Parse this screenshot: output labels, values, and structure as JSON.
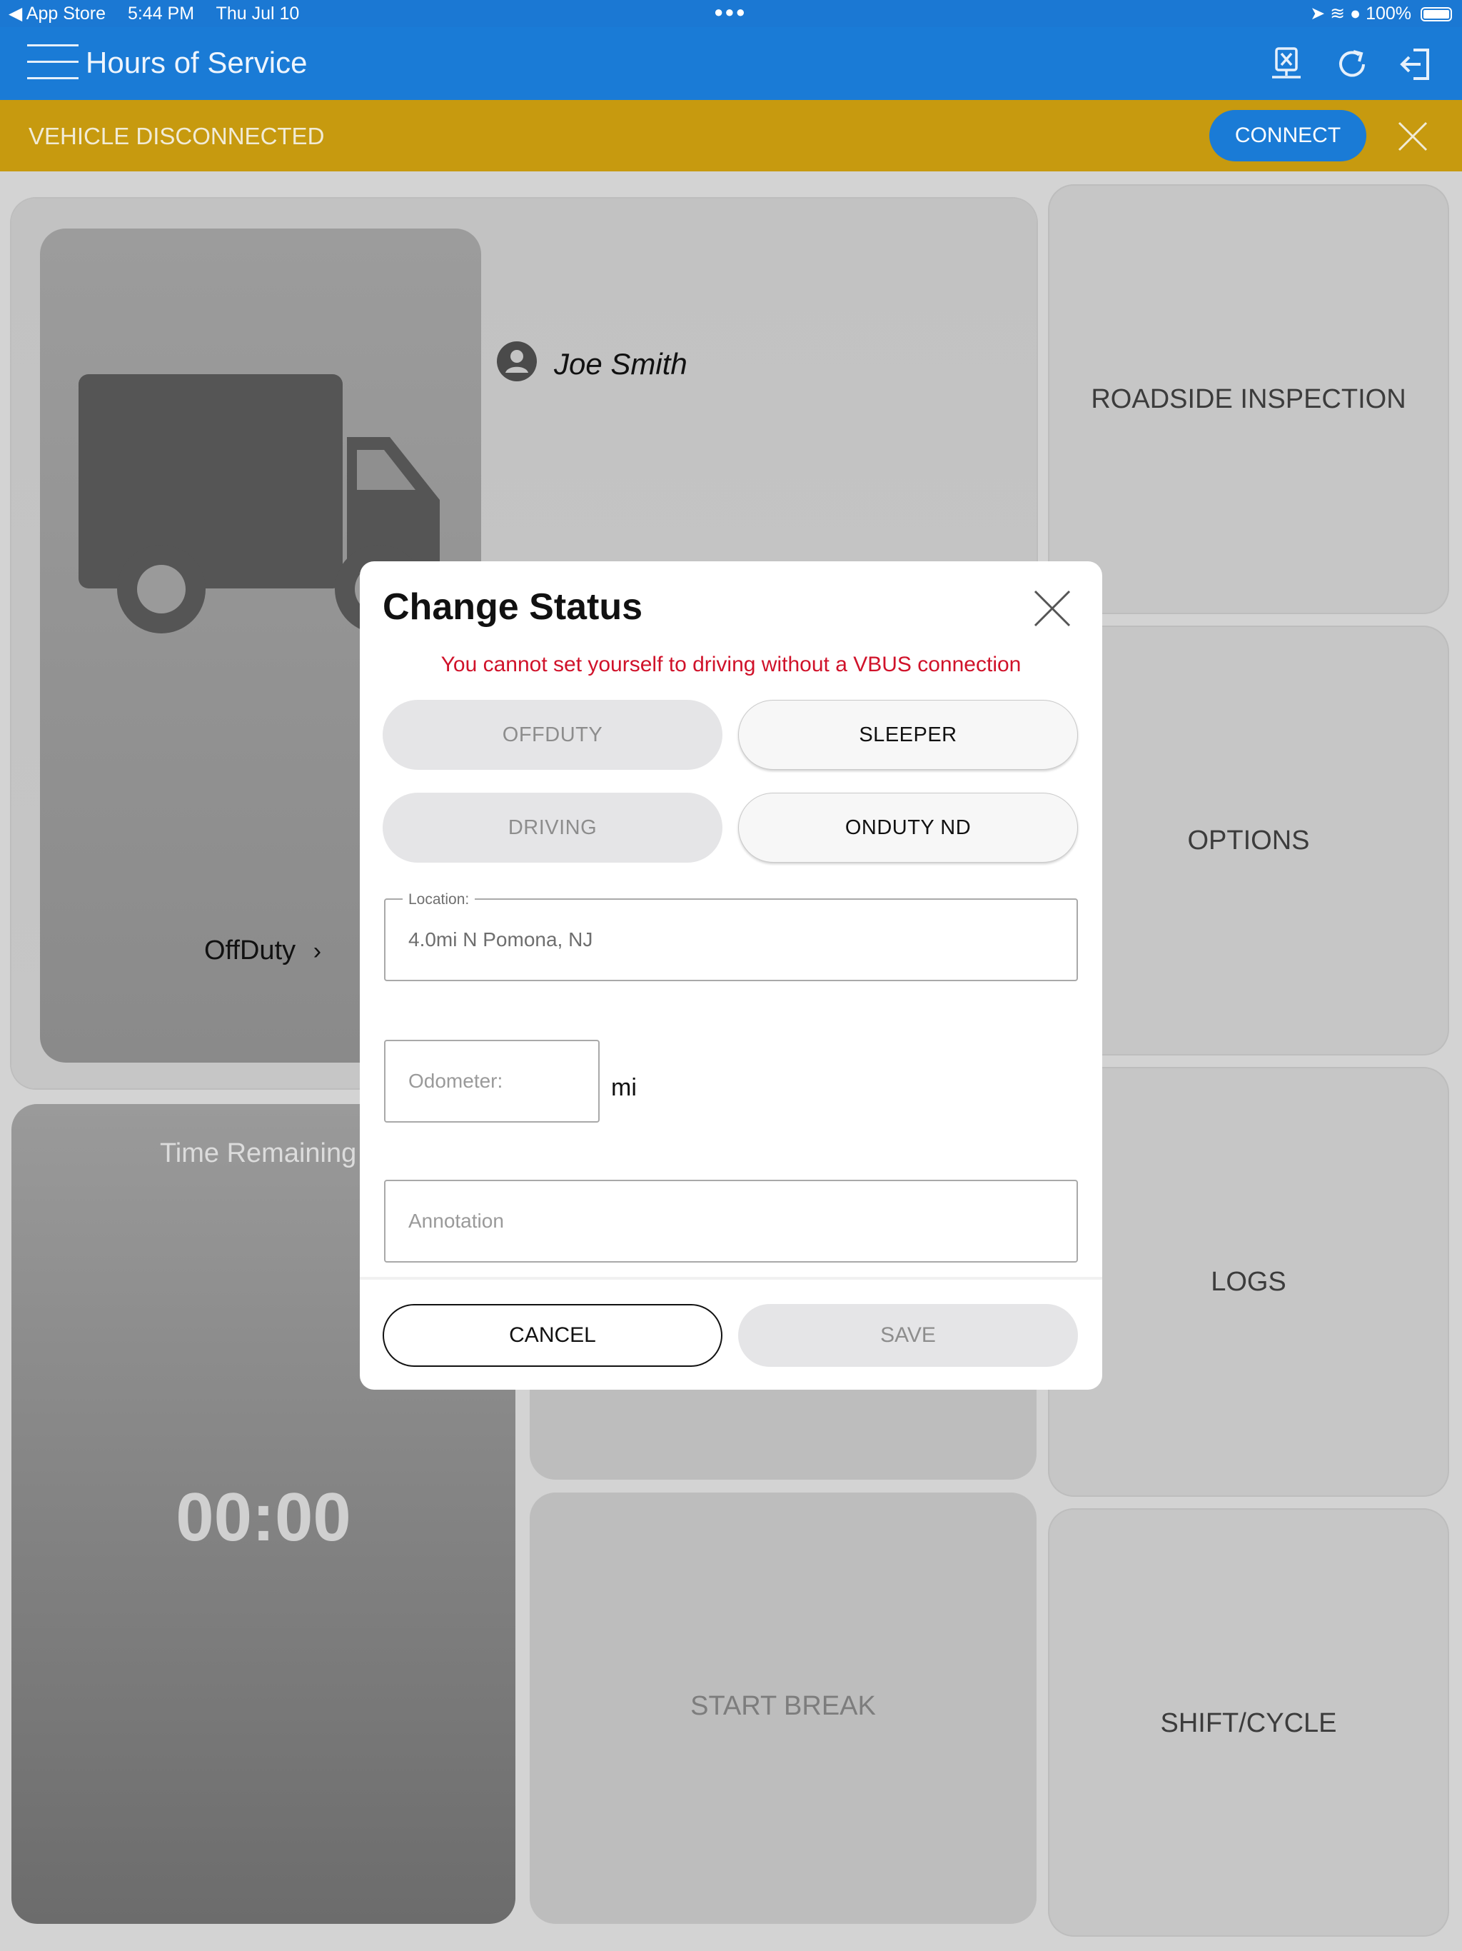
{
  "status_bar": {
    "back_app": "◀ App Store",
    "time": "5:44 PM",
    "date": "Thu Jul 10",
    "battery": "100%"
  },
  "app_bar": {
    "title": "Hours of Service"
  },
  "banner": {
    "message": "VEHICLE DISCONNECTED",
    "connect_label": "CONNECT"
  },
  "dashboard": {
    "driver_name": "Joe Smith",
    "current_status": "OffDuty",
    "time_remaining_label": "Time Remaining",
    "time_remaining_value": "00:00",
    "roadside_label": "ROADSIDE INSPECTION",
    "options_label": "OPTIONS",
    "logs_label": "LOGS",
    "start_break_label": "START BREAK",
    "shift_cycle_label": "SHIFT/CYCLE"
  },
  "modal": {
    "title": "Change Status",
    "error": "You cannot set yourself to driving without a VBUS connection",
    "status_options": [
      {
        "label": "OFFDUTY",
        "enabled": false
      },
      {
        "label": "SLEEPER",
        "enabled": true
      },
      {
        "label": "DRIVING",
        "enabled": false
      },
      {
        "label": "ONDUTY ND",
        "enabled": true
      }
    ],
    "location_legend": "Location:",
    "location_value": "4.0mi N Pomona, NJ",
    "odometer_placeholder": "Odometer:",
    "odometer_unit": "mi",
    "annotation_placeholder": "Annotation",
    "cancel_label": "CANCEL",
    "save_label": "SAVE"
  },
  "colors": {
    "app_bar": "#1a7bd6",
    "banner": "#c79a0f",
    "error": "#d0122a"
  }
}
